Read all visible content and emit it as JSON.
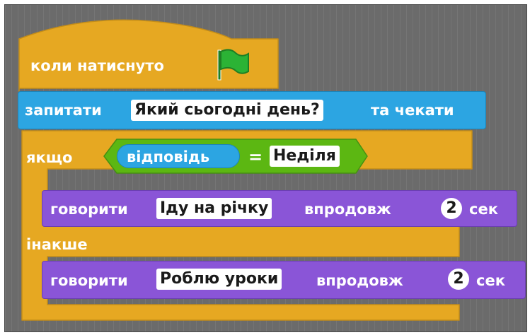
{
  "script": {
    "hat_label": "коли натиснуто",
    "ask_label": "запитати",
    "ask_question": "Який сьогодні день?",
    "ask_wait_label": "та чекати",
    "if_label": "якщо",
    "answer_label": "відповідь",
    "equals_label": "=",
    "compare_value": "Неділя",
    "say1_label": "говорити",
    "say1_text": "Іду на річку",
    "say1_for_label": "впродовж",
    "say1_seconds": "2",
    "say1_unit": "сек",
    "else_label": "інакше",
    "say2_label": "говорити",
    "say2_text": "Роблю уроки",
    "say2_for_label": "впродовж",
    "say2_seconds": "2",
    "say2_unit": "сек"
  },
  "colors": {
    "control": "#e6a822",
    "events": "#e6a822",
    "sensing": "#2ca5e2",
    "operators": "#5cb712",
    "looks": "#8a55d7",
    "canvas": "#6b6b6b",
    "flag": "#2bb335"
  },
  "icons": {
    "green_flag": "green-flag-icon"
  }
}
